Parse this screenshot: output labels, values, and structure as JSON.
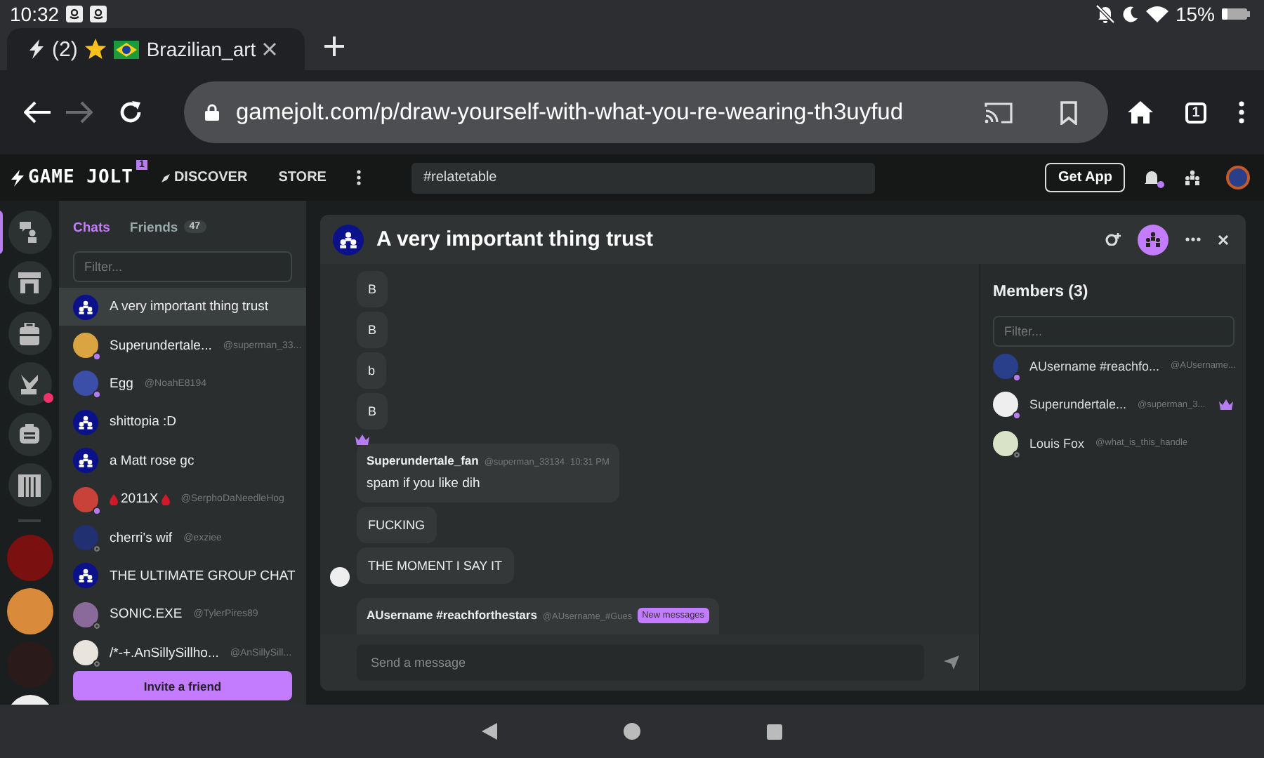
{
  "status_bar": {
    "time": "10:32",
    "battery": "15%"
  },
  "browser": {
    "tabs": [
      {
        "counter": "(2)",
        "title": "Brazilian_art",
        "selected": true
      }
    ],
    "url": "gamejolt.com/p/draw-yourself-with-what-you-re-wearing-th3uyfud",
    "tab_count": "1",
    "can_go_forward": false
  },
  "site_nav": {
    "logo": "GAME JOLT",
    "logo_badge": "1",
    "links": [
      "DISCOVER",
      "STORE"
    ],
    "search": {
      "value": "#relatetable"
    },
    "get_app": "Get App",
    "has_notifications": true
  },
  "rail": {
    "items": [
      {
        "kind": "chats",
        "selected": true,
        "alert": false
      },
      {
        "kind": "store",
        "selected": false,
        "alert": false
      },
      {
        "kind": "inventory",
        "selected": false,
        "alert": false
      },
      {
        "kind": "quests",
        "selected": false,
        "alert": true
      },
      {
        "kind": "shell",
        "selected": false,
        "alert": false
      },
      {
        "kind": "library",
        "selected": false,
        "alert": false
      },
      {
        "kind": "community",
        "selected": false,
        "alert": false
      },
      {
        "kind": "community",
        "selected": false,
        "alert": false
      },
      {
        "kind": "community",
        "selected": false,
        "alert": false
      },
      {
        "kind": "community",
        "selected": false,
        "alert": false
      }
    ]
  },
  "chat_list": {
    "tabs": [
      {
        "label": "Chats",
        "selected": true
      },
      {
        "label": "Friends",
        "count": "47",
        "selected": false
      }
    ],
    "filter": {
      "placeholder": "Filter..."
    },
    "items": [
      {
        "kind": "group",
        "name": "A very important thing trust",
        "selected": true
      },
      {
        "kind": "user",
        "name": "Superundertale...",
        "handle": "@superman_33...",
        "online": true,
        "selected": false
      },
      {
        "kind": "user",
        "name": "Egg",
        "handle": "@NoahE8194",
        "online": true,
        "selected": false
      },
      {
        "kind": "group",
        "name": "shittopia :D",
        "selected": false
      },
      {
        "kind": "group",
        "name": "a Matt rose gc",
        "selected": false
      },
      {
        "kind": "user",
        "name": "2011X",
        "handle": "@SerphoDaNeedleHog",
        "online": true,
        "drops": true,
        "selected": false
      },
      {
        "kind": "user",
        "name": "cherri's wif",
        "handle": "@exziee",
        "online": false,
        "selected": false
      },
      {
        "kind": "group",
        "name": "THE ULTIMATE GROUP CHAT",
        "selected": false
      },
      {
        "kind": "user",
        "name": "SONIC.EXE",
        "handle": "@TylerPires89",
        "online": false,
        "selected": false
      },
      {
        "kind": "user",
        "name": "/*-+.AnSillySillho...",
        "handle": "@AnSillySill...",
        "online": false,
        "selected": false
      }
    ],
    "invite_button": "Invite a friend"
  },
  "chat_room": {
    "title": "A very important thing trust",
    "members_open": true,
    "messages": [
      {
        "kind": "bubble",
        "text": "B",
        "avatar": false
      },
      {
        "kind": "bubble",
        "text": "B",
        "avatar": false
      },
      {
        "kind": "bubble",
        "text": "b",
        "avatar": false
      },
      {
        "kind": "bubble",
        "text": "B",
        "avatar": false
      },
      {
        "kind": "post",
        "author": "Superundertale_fan",
        "handle": "@superman_33134",
        "time": "10:31 PM",
        "text": "spam if you like dih",
        "owner": true
      },
      {
        "kind": "bubble",
        "text": "FUCKING",
        "avatar": false
      },
      {
        "kind": "bubble",
        "text": "THE MOMENT I SAY IT",
        "avatar": true
      },
      {
        "kind": "post",
        "author": "AUsername #reachforthestars",
        "handle": "@AUsername_#Gues",
        "owner": false
      }
    ],
    "new_messages_badge": "New messages",
    "composer": {
      "placeholder": "Send a message"
    },
    "members": {
      "title": "Members (3)",
      "filter": {
        "placeholder": "Filter..."
      },
      "items": [
        {
          "name": "AUsername #reachfo...",
          "handle": "@AUsername...",
          "online": true,
          "owner": false
        },
        {
          "name": "Superundertale...",
          "handle": "@superman_3...",
          "online": true,
          "owner": true
        },
        {
          "name": "Louis Fox",
          "handle": "@what_is_this_handle",
          "online": false,
          "owner": false
        }
      ]
    }
  }
}
